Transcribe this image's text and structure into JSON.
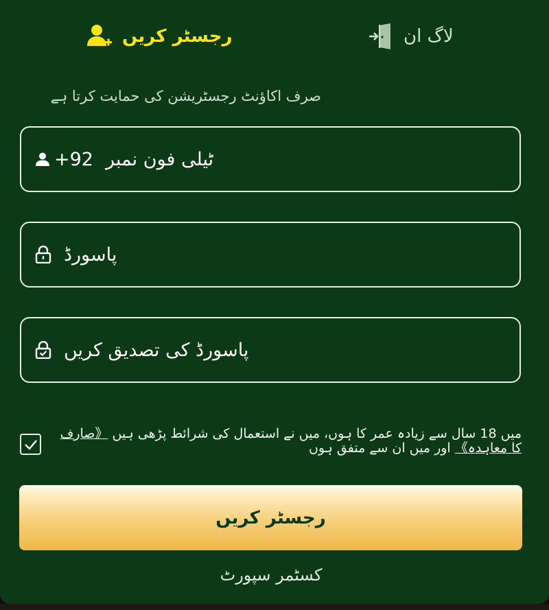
{
  "tabs": {
    "register_label": "رجسٹر کریں",
    "login_label": "لاگ ان",
    "active_color": "#f6e512"
  },
  "form": {
    "support_note": "صرف اکاؤنٹ رجسٹریشن کی حمایت کرتا ہے",
    "phone": {
      "prefix": "+92",
      "placeholder": "ٹیلی فون نمبر",
      "icon": "user-icon"
    },
    "password": {
      "placeholder": "پاسورڈ",
      "icon": "lock-icon"
    },
    "confirm_password": {
      "placeholder": "پاسورڈ کی تصدیق کریں",
      "icon": "lock-check-icon"
    },
    "agreement": {
      "checked": true,
      "text_before": "میں 18 سال سے زیادہ عمر کا ہوں، میں نے استعمال کی شرائط پڑھی ہیں ",
      "link_text": "《صارف کا معاہدہ》",
      "text_after": " اور میں ان سے متفق ہوں"
    },
    "submit_label": "رجسٹر کریں",
    "customer_support_label": "کسٹمر سپورٹ"
  },
  "colors": {
    "background": "#0c3a17",
    "button_gradient_end": "#eeb847"
  }
}
